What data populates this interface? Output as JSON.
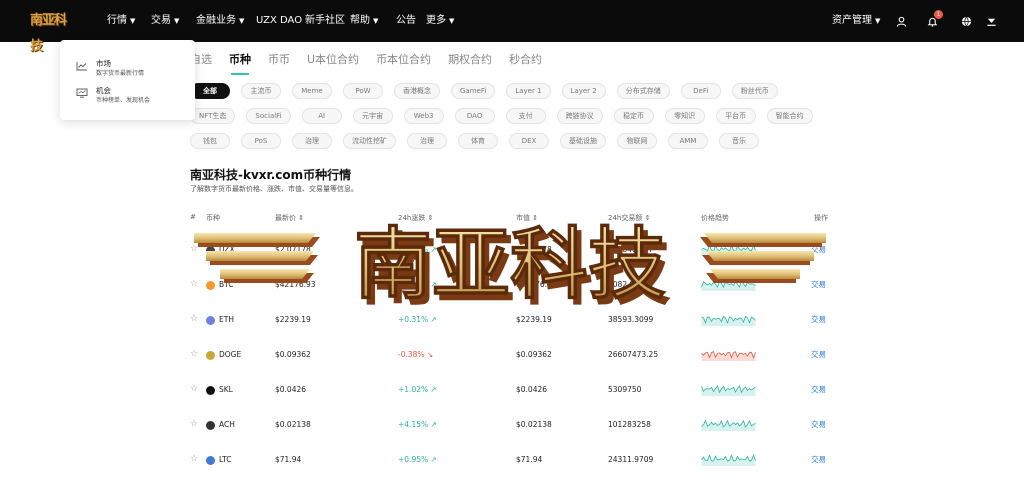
{
  "brand": {
    "logo_text": "南亚科技"
  },
  "nav": {
    "items": [
      {
        "label": "行情",
        "has_dropdown": true
      },
      {
        "label": "交易",
        "has_dropdown": true
      },
      {
        "label": "金融业务",
        "has_dropdown": true
      },
      {
        "label": "UZX DAO",
        "has_dropdown": false
      },
      {
        "label": "新手社区",
        "has_dropdown": false
      },
      {
        "label": "帮助",
        "has_dropdown": true
      },
      {
        "label": "公告",
        "has_dropdown": false
      },
      {
        "label": "更多",
        "has_dropdown": true
      }
    ],
    "assets_label": "资产管理",
    "notification_count": "1"
  },
  "dropdown": {
    "items": [
      {
        "title": "市场",
        "desc": "数字货币最新行情",
        "icon": "chart-line-icon"
      },
      {
        "title": "机会",
        "desc": "币种榜单、发现机会",
        "icon": "monitor-icon"
      }
    ]
  },
  "tabs": [
    "自选",
    "币种",
    "币币",
    "U本位合约",
    "币本位合约",
    "期权合约",
    "秒合约"
  ],
  "active_tab": "币种",
  "chips": [
    "全部",
    "主流币",
    "Meme",
    "PoW",
    "香港概念",
    "GameFi",
    "Layer 1",
    "Layer 2",
    "分布式存储",
    "DeFi",
    "粉丝代币",
    "NFT生态",
    "SocialFi",
    "AI",
    "元宇宙",
    "Web3",
    "DAO",
    "支付",
    "跨链协议",
    "稳定币",
    "零知识",
    "平台币",
    "智能合约",
    "钱包",
    "PoS",
    "治理",
    "流动性挖矿",
    "治理",
    "体育",
    "DEX",
    "基础设施",
    "物联网",
    "AMM",
    "音乐"
  ],
  "active_chip": "全部",
  "section": {
    "title": "南亚科技-kvxr.com币种行情",
    "desc": "了解数字货币最新价格、涨跌、市值、交易量等信息。"
  },
  "table": {
    "headers": [
      "#",
      "币种",
      "最新价",
      "24h涨跌",
      "市值",
      "24h交易额",
      "价格趋势",
      "操作"
    ],
    "rows": [
      {
        "coin": "UZX",
        "price": "$2.07178",
        "change": "+1.33%",
        "dir": "up",
        "mcap": "$2.07178",
        "volume": "5738467.67",
        "action": "交易",
        "color": "#444444"
      },
      {
        "coin": "BTC",
        "price": "$42176.93",
        "change": "+0.56%",
        "dir": "up",
        "mcap": "$42176.93",
        "volume": "1082.9372",
        "action": "交易",
        "color": "#f39a2b"
      },
      {
        "coin": "ETH",
        "price": "$2239.19",
        "change": "+0.31%",
        "dir": "up",
        "mcap": "$2239.19",
        "volume": "38593.3099",
        "action": "交易",
        "color": "#6f7fe8"
      },
      {
        "coin": "DOGE",
        "price": "$0.09362",
        "change": "-0.38%",
        "dir": "down",
        "mcap": "$0.09362",
        "volume": "26607473.25",
        "action": "交易",
        "color": "#c9a53a"
      },
      {
        "coin": "SKL",
        "price": "$0.0426",
        "change": "+1.02%",
        "dir": "up",
        "mcap": "$0.0426",
        "volume": "5309750",
        "action": "交易",
        "color": "#111111"
      },
      {
        "coin": "ACH",
        "price": "$0.02138",
        "change": "+4.15%",
        "dir": "up",
        "mcap": "$0.02138",
        "volume": "101283258",
        "action": "交易",
        "color": "#333333"
      },
      {
        "coin": "LTC",
        "price": "$71.94",
        "change": "+0.95%",
        "dir": "up",
        "mcap": "$71.94",
        "volume": "24311.9709",
        "action": "交易",
        "color": "#3a7bd5"
      }
    ]
  },
  "watermark": {
    "text": "南亚科技"
  },
  "colors": {
    "accent": "#35c1b2",
    "up": "#2bb3a3",
    "down": "#e05a4a",
    "link": "#2a7ee0"
  }
}
